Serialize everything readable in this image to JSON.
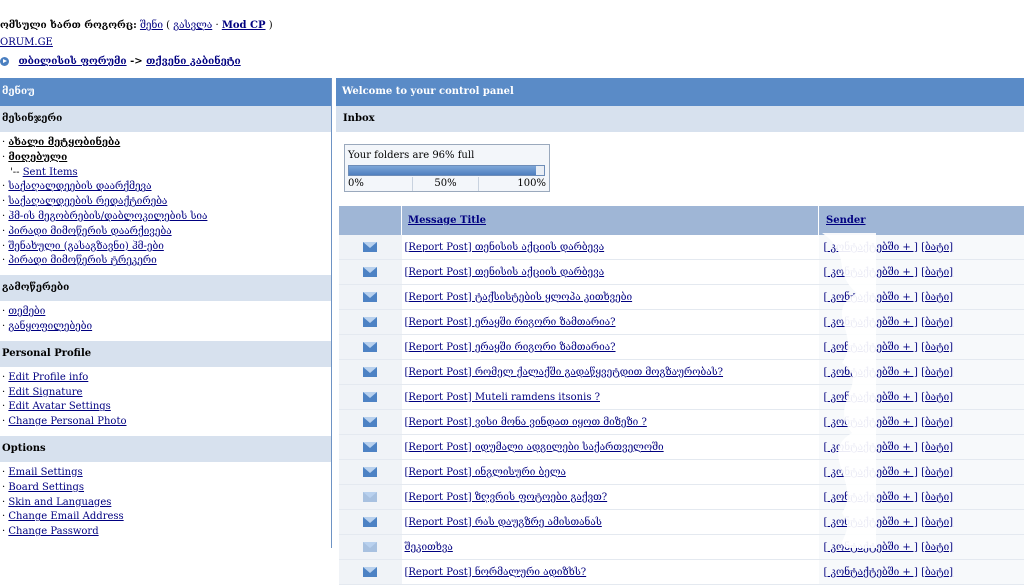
{
  "header": {
    "logged_in_prefix": "ომსული ხართ როგორც:",
    "username": "შენი",
    "logout_label": "გასვლა",
    "separator": "·",
    "mod_cp_label": "Mod CP",
    "site_link": "ORUM.GE",
    "breadcrumb_root": "თბილისის ფორუმი",
    "breadcrumb_arrow": "->",
    "breadcrumb_current": "თქვენი კაბინეტი"
  },
  "sidebar": {
    "menu_title": "მენიუ",
    "sections": [
      {
        "title": "მესინჯერი",
        "items": [
          {
            "label": "ახალი მეტყობინება",
            "strong": true
          },
          {
            "label": "მიღებული",
            "strong": true
          },
          {
            "label": "Sent Items",
            "sub": true,
            "prefix": "'-- "
          },
          {
            "label": "საქაღალდეების დაარქმევა"
          },
          {
            "label": "საქაღალდეების რედაქტირება"
          },
          {
            "label": "ჰმ-ის მეგობრების/დაბლოკილების სია"
          },
          {
            "label": "პირადი მიმოწერის დაარქივება"
          },
          {
            "label": "შენახული (გასაგზავნი) ჰმ-ები"
          },
          {
            "label": "პირადი მიმოწერის ტრეკერი"
          }
        ]
      },
      {
        "title": "გამოწერები",
        "items": [
          {
            "label": "თემები"
          },
          {
            "label": "განყოფილებები"
          }
        ]
      },
      {
        "title": "Personal Profile",
        "items": [
          {
            "label": "Edit Profile info"
          },
          {
            "label": "Edit Signature"
          },
          {
            "label": "Edit Avatar Settings"
          },
          {
            "label": "Change Personal Photo"
          }
        ]
      },
      {
        "title": "Options",
        "items": [
          {
            "label": "Email Settings"
          },
          {
            "label": "Board Settings"
          },
          {
            "label": "Skin and Languages"
          },
          {
            "label": "Change Email Address"
          },
          {
            "label": "Change Password"
          }
        ]
      }
    ]
  },
  "main": {
    "welcome_title": "Welcome to your control panel",
    "inbox_title": "Inbox",
    "quota": {
      "text": "Your folders are 96% full",
      "percent": 96,
      "scale": [
        "0%",
        "50%",
        "100%"
      ]
    },
    "columns": {
      "title": "Message Title",
      "sender": "Sender"
    },
    "messages": [
      {
        "title": "[Report Post] თენისის აქციის დარბევა",
        "sender": "[ კონტაქტებში + ]",
        "block": "[ბატი]",
        "read": false
      },
      {
        "title": "[Report Post] თენისის აქციის დარბევა",
        "sender": "[ კონტაქტებში + ]",
        "block": "[ბატი]",
        "read": false
      },
      {
        "title": "[Report Post] ტაქსისტების ყლოპა კითხვები",
        "sender": "[ კონტაქტებში + ]",
        "block": "[ბატი]",
        "read": false
      },
      {
        "title": "[Report Post] ერაყში რიგორი ზამთარია?",
        "sender": "[ კონტაქტებში + ]",
        "block": "[ბატი]",
        "read": false
      },
      {
        "title": "[Report Post] ერაყში რიგორი ზამთარია?",
        "sender": "[ კონტაქტებში + ]",
        "block": "[ბატი]",
        "read": false
      },
      {
        "title": "[Report Post] რომელ ქალაქში გადაწყვეტდით მოგზაურობას?",
        "sender": "[ კონტაქტებში + ]",
        "block": "[ბატი]",
        "read": false
      },
      {
        "title": "[Report Post] Muteli ramdens itsonis ?",
        "sender": "[ კონტაქტებში + ]",
        "block": "[ბატი]",
        "read": false
      },
      {
        "title": "[Report Post] ვისი მონა ვინდათ იყოთ მიზეზი ?",
        "sender": "[ კონტაქტებში + ]",
        "block": "[ბატი]",
        "read": false
      },
      {
        "title": "[Report Post] იდუმალი ადგილები საქართველოში",
        "sender": "[ კონტაქტებში + ]",
        "block": "[ბატი]",
        "read": false
      },
      {
        "title": "[Report Post] ინგლისური ბელა",
        "sender": "[ კონტაქტებში + ]",
        "block": "[ბატი]",
        "read": false
      },
      {
        "title": "[Report Post] ზღვრის ფოტოები გაქვთ?",
        "sender": "[ კონტაქტებში + ]",
        "block": "[ბატი]",
        "read": true
      },
      {
        "title": "[Report Post] რას დაუგზრე ამისთანას",
        "sender": "[ კონტაქტებში + ]",
        "block": "[ბატი]",
        "read": false
      },
      {
        "title": "შეკითხვა",
        "sender": "[ კონტაქტებში + ]",
        "block": "[ბატი]",
        "read": true
      },
      {
        "title": "[Report Post] ნორმალური ადიზხს?",
        "sender": "[ კონტაქტებში + ]",
        "block": "[ბატი]",
        "read": false
      }
    ]
  }
}
